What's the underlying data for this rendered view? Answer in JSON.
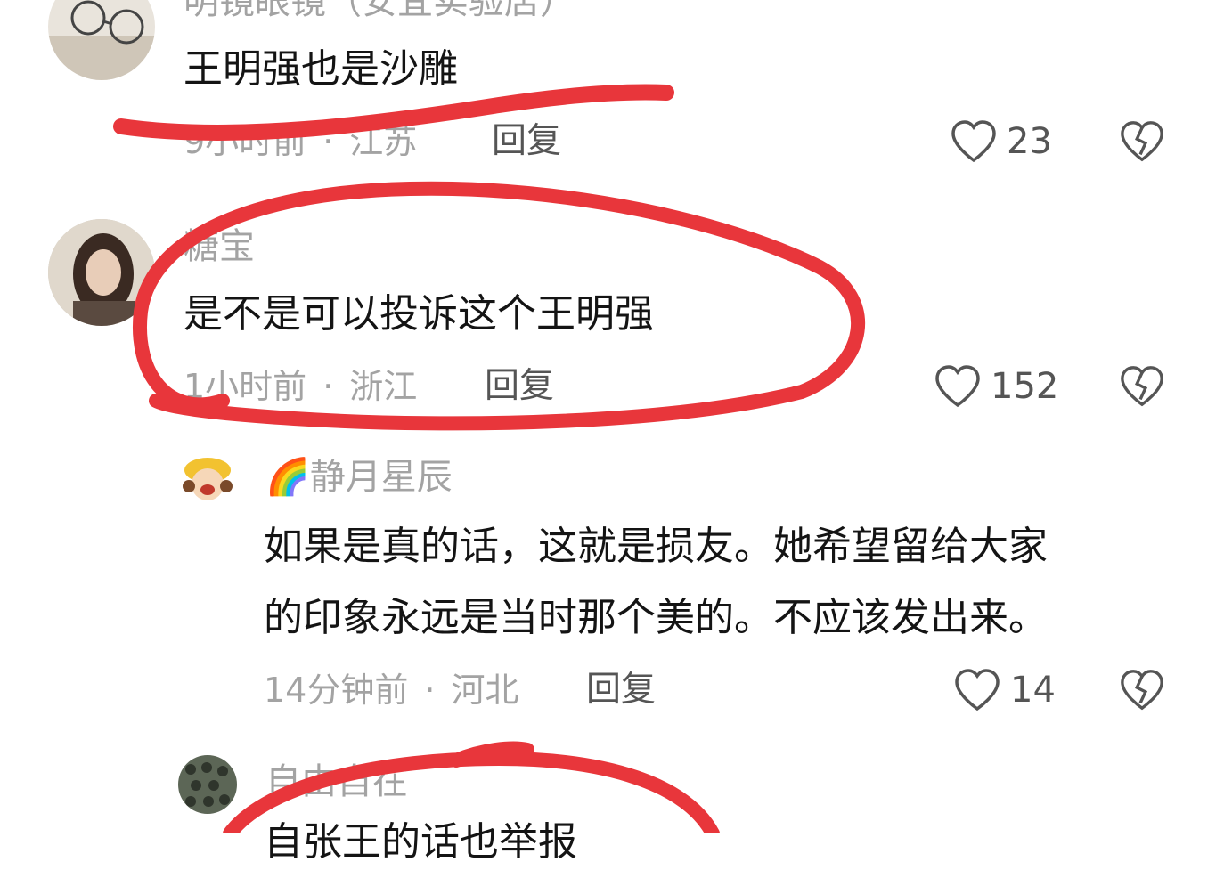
{
  "comments": [
    {
      "username": "明镜眼镜（安宜实验店）",
      "content": "王明强也是沙雕",
      "time": "9小时前",
      "location": "江苏",
      "reply_label": "回复",
      "likes": "23"
    },
    {
      "username": "糖宝",
      "content": "是不是可以投诉这个王明强",
      "time": "1小时前",
      "location": "浙江",
      "reply_label": "回复",
      "likes": "152"
    },
    {
      "username": "静月星辰",
      "username_emoji": "🌈",
      "content_line1": "如果是真的话，这就是损友。她希望留给大家",
      "content_line2": "的印象永远是当时那个美的。不应该发出来。",
      "time": "14分钟前",
      "location": "河北",
      "reply_label": "回复",
      "likes": "14"
    },
    {
      "username": "自由自在",
      "content": "自张王的话也举报"
    }
  ],
  "separator": "·",
  "icons": {
    "like": "heart-outline-icon",
    "dislike": "broken-heart-icon"
  },
  "colors": {
    "annotation_red": "#e8363b",
    "meta_gray": "#a3a3a3"
  }
}
